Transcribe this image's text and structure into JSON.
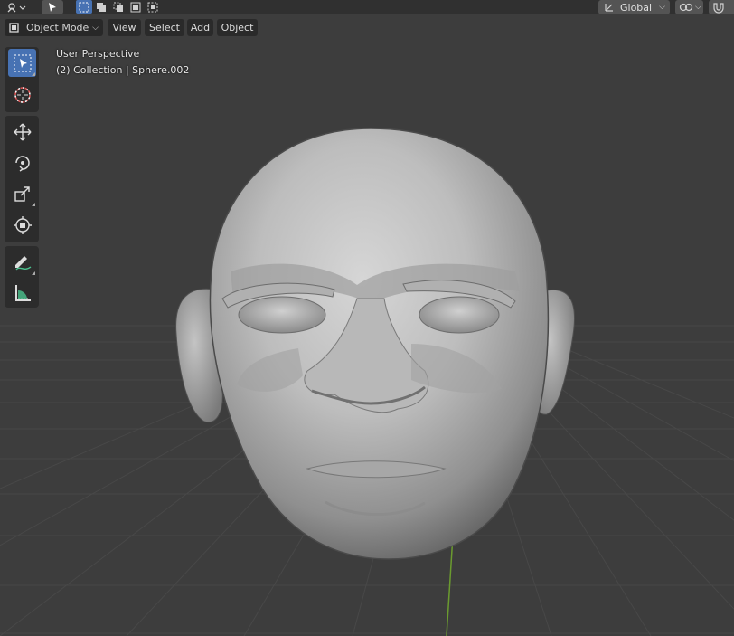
{
  "header": {
    "transform_orientation": "Global"
  },
  "viewport_header": {
    "mode": "Object Mode",
    "menus": [
      "View",
      "Select",
      "Add",
      "Object"
    ]
  },
  "overlay": {
    "view_name": "User Perspective",
    "collection_info": "(2) Collection | Sphere.002"
  },
  "toolbar": {
    "tools": [
      "select-box-tool",
      "cursor-tool",
      "move-tool",
      "rotate-tool",
      "scale-tool",
      "transform-tool",
      "annotate-tool",
      "measure-tool"
    ],
    "active_tool": "select-box-tool"
  },
  "colors": {
    "background": "#3d3d3d",
    "grid": "#484848",
    "accent": "#4772b3",
    "y_axis": "#6b9b2f",
    "mesh": "#b9b9b9"
  }
}
